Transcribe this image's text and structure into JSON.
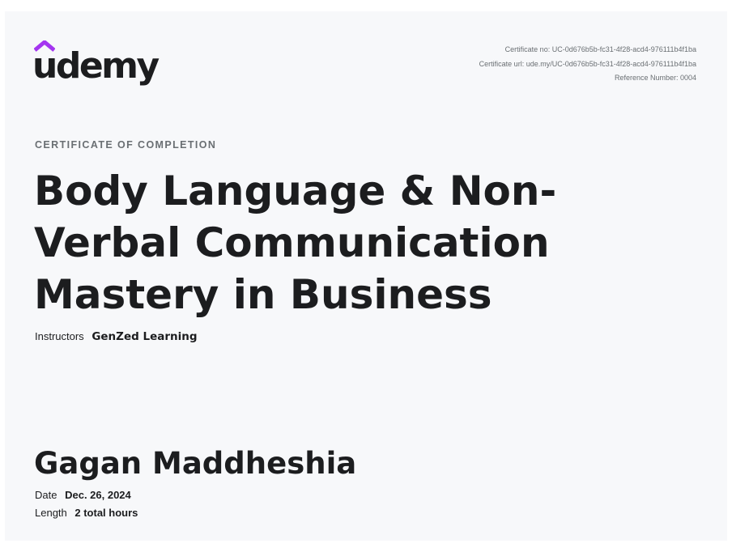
{
  "brand": {
    "name": "udemy",
    "accent_color": "#a435f0",
    "text_color": "#1c1d1f"
  },
  "meta": {
    "certificate_no": "Certificate no: UC-0d676b5b-fc31-4f28-acd4-976111b4f1ba",
    "certificate_url": "Certificate url: ude.my/UC-0d676b5b-fc31-4f28-acd4-976111b4f1ba",
    "reference_number": "Reference Number: 0004"
  },
  "certificate": {
    "label": "CERTIFICATE OF COMPLETION",
    "course_title": "Body Language & Non-Verbal Communication Mastery in Business",
    "instructors_label": "Instructors",
    "instructors": "GenZed Learning",
    "recipient": "Gagan Maddheshia",
    "date_label": "Date",
    "date": "Dec. 26, 2024",
    "length_label": "Length",
    "length": "2 total hours"
  },
  "colors": {
    "background": "#f7f8fa",
    "muted_text": "#6a6f73"
  }
}
